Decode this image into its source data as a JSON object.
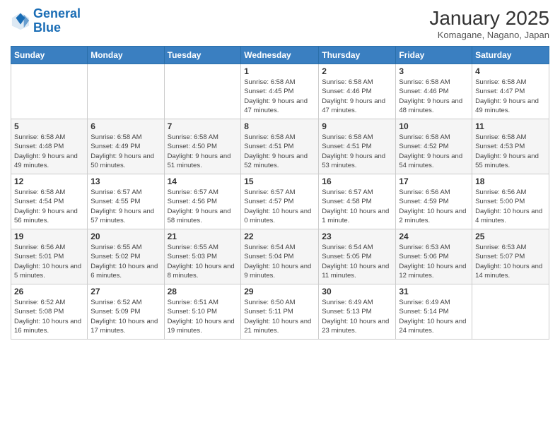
{
  "header": {
    "logo_line1": "General",
    "logo_line2": "Blue",
    "month": "January 2025",
    "location": "Komagane, Nagano, Japan"
  },
  "days_of_week": [
    "Sunday",
    "Monday",
    "Tuesday",
    "Wednesday",
    "Thursday",
    "Friday",
    "Saturday"
  ],
  "weeks": [
    [
      {
        "day": "",
        "info": ""
      },
      {
        "day": "",
        "info": ""
      },
      {
        "day": "",
        "info": ""
      },
      {
        "day": "1",
        "info": "Sunrise: 6:58 AM\nSunset: 4:45 PM\nDaylight: 9 hours and 47 minutes."
      },
      {
        "day": "2",
        "info": "Sunrise: 6:58 AM\nSunset: 4:46 PM\nDaylight: 9 hours and 47 minutes."
      },
      {
        "day": "3",
        "info": "Sunrise: 6:58 AM\nSunset: 4:46 PM\nDaylight: 9 hours and 48 minutes."
      },
      {
        "day": "4",
        "info": "Sunrise: 6:58 AM\nSunset: 4:47 PM\nDaylight: 9 hours and 49 minutes."
      }
    ],
    [
      {
        "day": "5",
        "info": "Sunrise: 6:58 AM\nSunset: 4:48 PM\nDaylight: 9 hours and 49 minutes."
      },
      {
        "day": "6",
        "info": "Sunrise: 6:58 AM\nSunset: 4:49 PM\nDaylight: 9 hours and 50 minutes."
      },
      {
        "day": "7",
        "info": "Sunrise: 6:58 AM\nSunset: 4:50 PM\nDaylight: 9 hours and 51 minutes."
      },
      {
        "day": "8",
        "info": "Sunrise: 6:58 AM\nSunset: 4:51 PM\nDaylight: 9 hours and 52 minutes."
      },
      {
        "day": "9",
        "info": "Sunrise: 6:58 AM\nSunset: 4:51 PM\nDaylight: 9 hours and 53 minutes."
      },
      {
        "day": "10",
        "info": "Sunrise: 6:58 AM\nSunset: 4:52 PM\nDaylight: 9 hours and 54 minutes."
      },
      {
        "day": "11",
        "info": "Sunrise: 6:58 AM\nSunset: 4:53 PM\nDaylight: 9 hours and 55 minutes."
      }
    ],
    [
      {
        "day": "12",
        "info": "Sunrise: 6:58 AM\nSunset: 4:54 PM\nDaylight: 9 hours and 56 minutes."
      },
      {
        "day": "13",
        "info": "Sunrise: 6:57 AM\nSunset: 4:55 PM\nDaylight: 9 hours and 57 minutes."
      },
      {
        "day": "14",
        "info": "Sunrise: 6:57 AM\nSunset: 4:56 PM\nDaylight: 9 hours and 58 minutes."
      },
      {
        "day": "15",
        "info": "Sunrise: 6:57 AM\nSunset: 4:57 PM\nDaylight: 10 hours and 0 minutes."
      },
      {
        "day": "16",
        "info": "Sunrise: 6:57 AM\nSunset: 4:58 PM\nDaylight: 10 hours and 1 minute."
      },
      {
        "day": "17",
        "info": "Sunrise: 6:56 AM\nSunset: 4:59 PM\nDaylight: 10 hours and 2 minutes."
      },
      {
        "day": "18",
        "info": "Sunrise: 6:56 AM\nSunset: 5:00 PM\nDaylight: 10 hours and 4 minutes."
      }
    ],
    [
      {
        "day": "19",
        "info": "Sunrise: 6:56 AM\nSunset: 5:01 PM\nDaylight: 10 hours and 5 minutes."
      },
      {
        "day": "20",
        "info": "Sunrise: 6:55 AM\nSunset: 5:02 PM\nDaylight: 10 hours and 6 minutes."
      },
      {
        "day": "21",
        "info": "Sunrise: 6:55 AM\nSunset: 5:03 PM\nDaylight: 10 hours and 8 minutes."
      },
      {
        "day": "22",
        "info": "Sunrise: 6:54 AM\nSunset: 5:04 PM\nDaylight: 10 hours and 9 minutes."
      },
      {
        "day": "23",
        "info": "Sunrise: 6:54 AM\nSunset: 5:05 PM\nDaylight: 10 hours and 11 minutes."
      },
      {
        "day": "24",
        "info": "Sunrise: 6:53 AM\nSunset: 5:06 PM\nDaylight: 10 hours and 12 minutes."
      },
      {
        "day": "25",
        "info": "Sunrise: 6:53 AM\nSunset: 5:07 PM\nDaylight: 10 hours and 14 minutes."
      }
    ],
    [
      {
        "day": "26",
        "info": "Sunrise: 6:52 AM\nSunset: 5:08 PM\nDaylight: 10 hours and 16 minutes."
      },
      {
        "day": "27",
        "info": "Sunrise: 6:52 AM\nSunset: 5:09 PM\nDaylight: 10 hours and 17 minutes."
      },
      {
        "day": "28",
        "info": "Sunrise: 6:51 AM\nSunset: 5:10 PM\nDaylight: 10 hours and 19 minutes."
      },
      {
        "day": "29",
        "info": "Sunrise: 6:50 AM\nSunset: 5:11 PM\nDaylight: 10 hours and 21 minutes."
      },
      {
        "day": "30",
        "info": "Sunrise: 6:49 AM\nSunset: 5:13 PM\nDaylight: 10 hours and 23 minutes."
      },
      {
        "day": "31",
        "info": "Sunrise: 6:49 AM\nSunset: 5:14 PM\nDaylight: 10 hours and 24 minutes."
      },
      {
        "day": "",
        "info": ""
      }
    ]
  ]
}
